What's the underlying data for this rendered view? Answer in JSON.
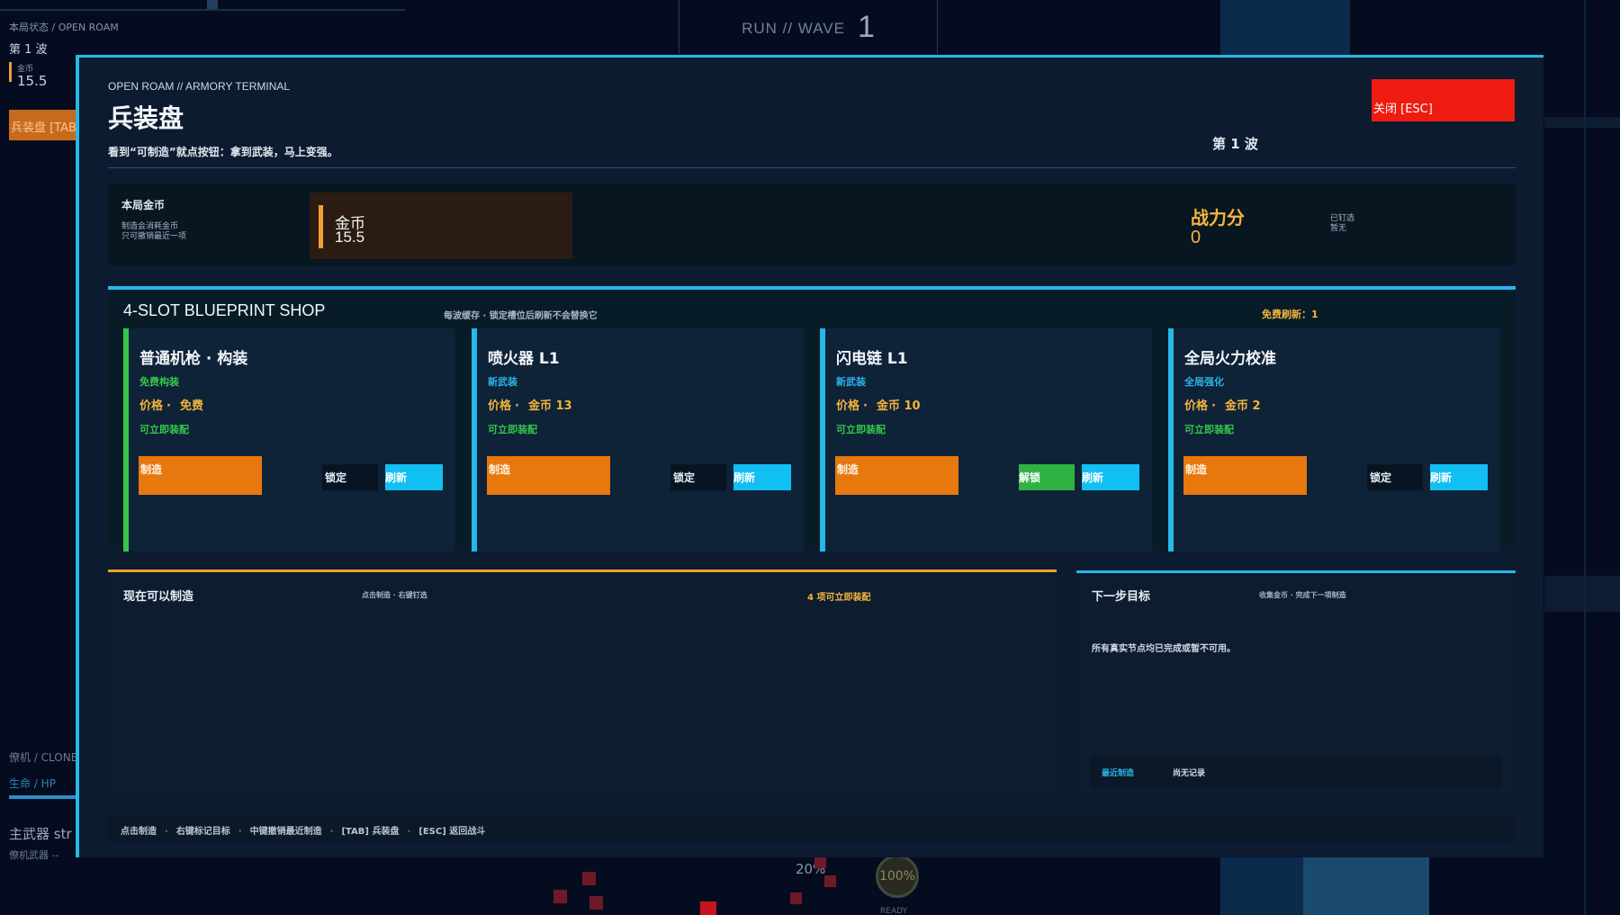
{
  "hud": {
    "crumb": "本局状态 / OPEN ROAM",
    "wave": "第 1 波",
    "gold_label": "金币",
    "gold_value": "15.5",
    "tab_button": "兵装盘 [TAB]",
    "run_label": "RUN  //  WAVE",
    "run_wave": "1",
    "clone_label": "僚机 / CLONE",
    "hp_label": "生命 / HP",
    "main_weapon": "主武器 str",
    "wingman_weapon": "僚机武器 --",
    "charge_pct": "20%",
    "ready_pct": "100%",
    "ready_label": "READY"
  },
  "modal": {
    "eyebrow": "OPEN ROAM // ARMORY TERMINAL",
    "title": "兵装盘",
    "subtitle": "看到“可制造”就点按钮：拿到武装，马上变强。",
    "wave": "第 1 波",
    "close_label": "关闭  [ESC]"
  },
  "gold_panel": {
    "heading": "本局金币",
    "desc1": "制造会消耗金币",
    "desc2": "只可撤销最近一项",
    "gold_label": "金币",
    "gold_value": "15.5",
    "power_label": "战力分",
    "power_value": "0",
    "pinned_label": "已钉选",
    "pinned_value": "暂无"
  },
  "shop": {
    "title": "4-SLOT BLUEPRINT SHOP",
    "note": "每波缓存 · 锁定槽位后刷新不会替换它",
    "free_refresh": "免费刷新：1",
    "price_label": "价格",
    "craft_label": "制造",
    "refresh_label": "刷新",
    "cards": [
      {
        "name": "普通机枪 · 构装",
        "tag": "免费构装",
        "price": "免费",
        "status": "可立即装配",
        "toggle": "锁定"
      },
      {
        "name": "喷火器 L1",
        "tag": "新武装",
        "price": "金币 13",
        "status": "可立即装配",
        "toggle": "锁定"
      },
      {
        "name": "闪电链 L1",
        "tag": "新武装",
        "price": "金币 10",
        "status": "可立即装配",
        "toggle": "解锁"
      },
      {
        "name": "全局火力校准",
        "tag": "全局强化",
        "price": "金币 2",
        "status": "可立即装配",
        "toggle": "锁定"
      }
    ]
  },
  "craftable": {
    "heading": "现在可以制造",
    "hint": "点击制造 · 右键钉选",
    "count": "4 项可立即装配"
  },
  "next_target": {
    "heading": "下一步目标",
    "hint": "收集金币 · 完成下一项制造",
    "message": "所有真实节点均已完成或暂不可用。",
    "recent_label": "最近制造",
    "recent_value": "尚无记录"
  },
  "footer": {
    "items": [
      "点击制造",
      "右键标记目标",
      "中键撤销最近制造",
      "[TAB] 兵装盘",
      "[ESC] 返回战斗"
    ]
  },
  "colors": {
    "accent": "#26b8e6",
    "gold": "#f3b43c",
    "craft": "#e6780e",
    "close": "#ee1b10",
    "ok": "#35c64a"
  }
}
